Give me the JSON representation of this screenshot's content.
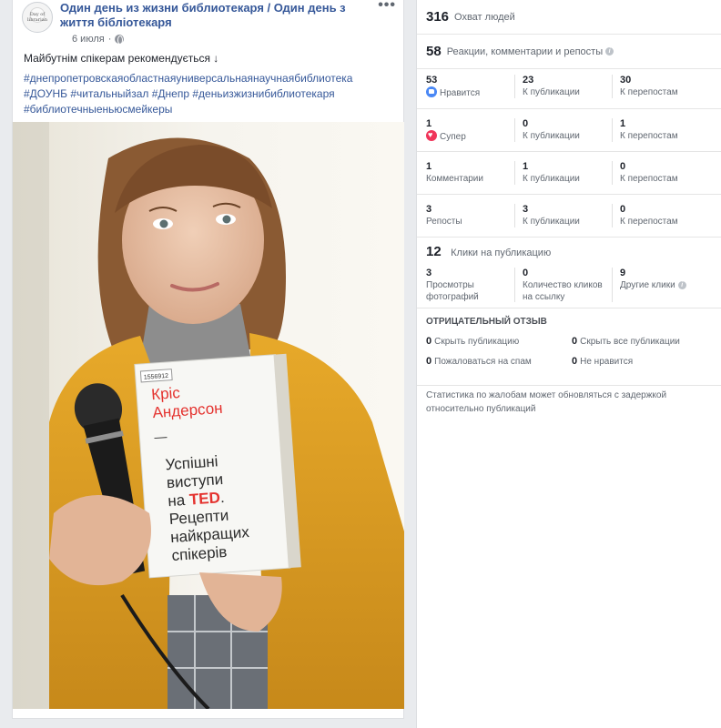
{
  "post": {
    "page_name": "Один день из жизни библиотекаря / Один день з життя бібліотекаря",
    "date": "6 июля",
    "avatar_text": "Day of librarian",
    "text": "Майбутнім спікерам рекомендується ↓",
    "hashtags": [
      "#днепропетровскаяобластнаяуниверсальнаянаучнаябиблиотека",
      "#ДОУНБ #читальныйзал #Днепр #деньизжизнибиблиотекаря",
      "#библиотечныеньюсмейкеры"
    ],
    "more_icon": "more-dots-icon",
    "privacy_icon": "globe-icon",
    "book": {
      "sticker": "1556912",
      "author": [
        "Кріс",
        "Андерсон"
      ],
      "dash": "—",
      "title_lines": [
        "Успішні",
        "виступи",
        "на",
        "Рецепти",
        "найкращих",
        "спікерів"
      ],
      "ted": "TED"
    }
  },
  "insights": {
    "reach": {
      "value": "316",
      "label": "Охват людей"
    },
    "engagement": {
      "value": "58",
      "label": "Реакции, комментарии и репосты"
    },
    "reactions": [
      {
        "count": "53",
        "label": "Нравится",
        "icon": "like-icon",
        "on_post": "23",
        "on_post_label": "К публикации",
        "on_shares": "30",
        "on_shares_label": "К перепостам"
      },
      {
        "count": "1",
        "label": "Супер",
        "icon": "love-icon",
        "on_post": "0",
        "on_post_label": "К публикации",
        "on_shares": "1",
        "on_shares_label": "К перепостам"
      },
      {
        "count": "1",
        "label": "Комментарии",
        "icon": "",
        "on_post": "1",
        "on_post_label": "К публикации",
        "on_shares": "0",
        "on_shares_label": "К перепостам"
      },
      {
        "count": "3",
        "label": "Репосты",
        "icon": "",
        "on_post": "3",
        "on_post_label": "К публикации",
        "on_shares": "0",
        "on_shares_label": "К перепостам"
      }
    ],
    "clicks": {
      "value": "12",
      "label": "Клики на публикацию",
      "items": [
        {
          "value": "3",
          "label": "Просмотры фотографий"
        },
        {
          "value": "0",
          "label": "Количество кликов на ссылку"
        },
        {
          "value": "9",
          "label": "Другие клики"
        }
      ]
    },
    "negative": {
      "title": "ОТРИЦАТЕЛЬНЫЙ ОТЗЫВ",
      "items": [
        {
          "value": "0",
          "label": "Скрыть публикацию"
        },
        {
          "value": "0",
          "label": "Скрыть все публикации"
        },
        {
          "value": "0",
          "label": "Пожаловаться на спам"
        },
        {
          "value": "0",
          "label": "Не нравится"
        }
      ]
    },
    "note": "Статистика по жалобам может обновляться с задержкой относительно публикаций"
  }
}
